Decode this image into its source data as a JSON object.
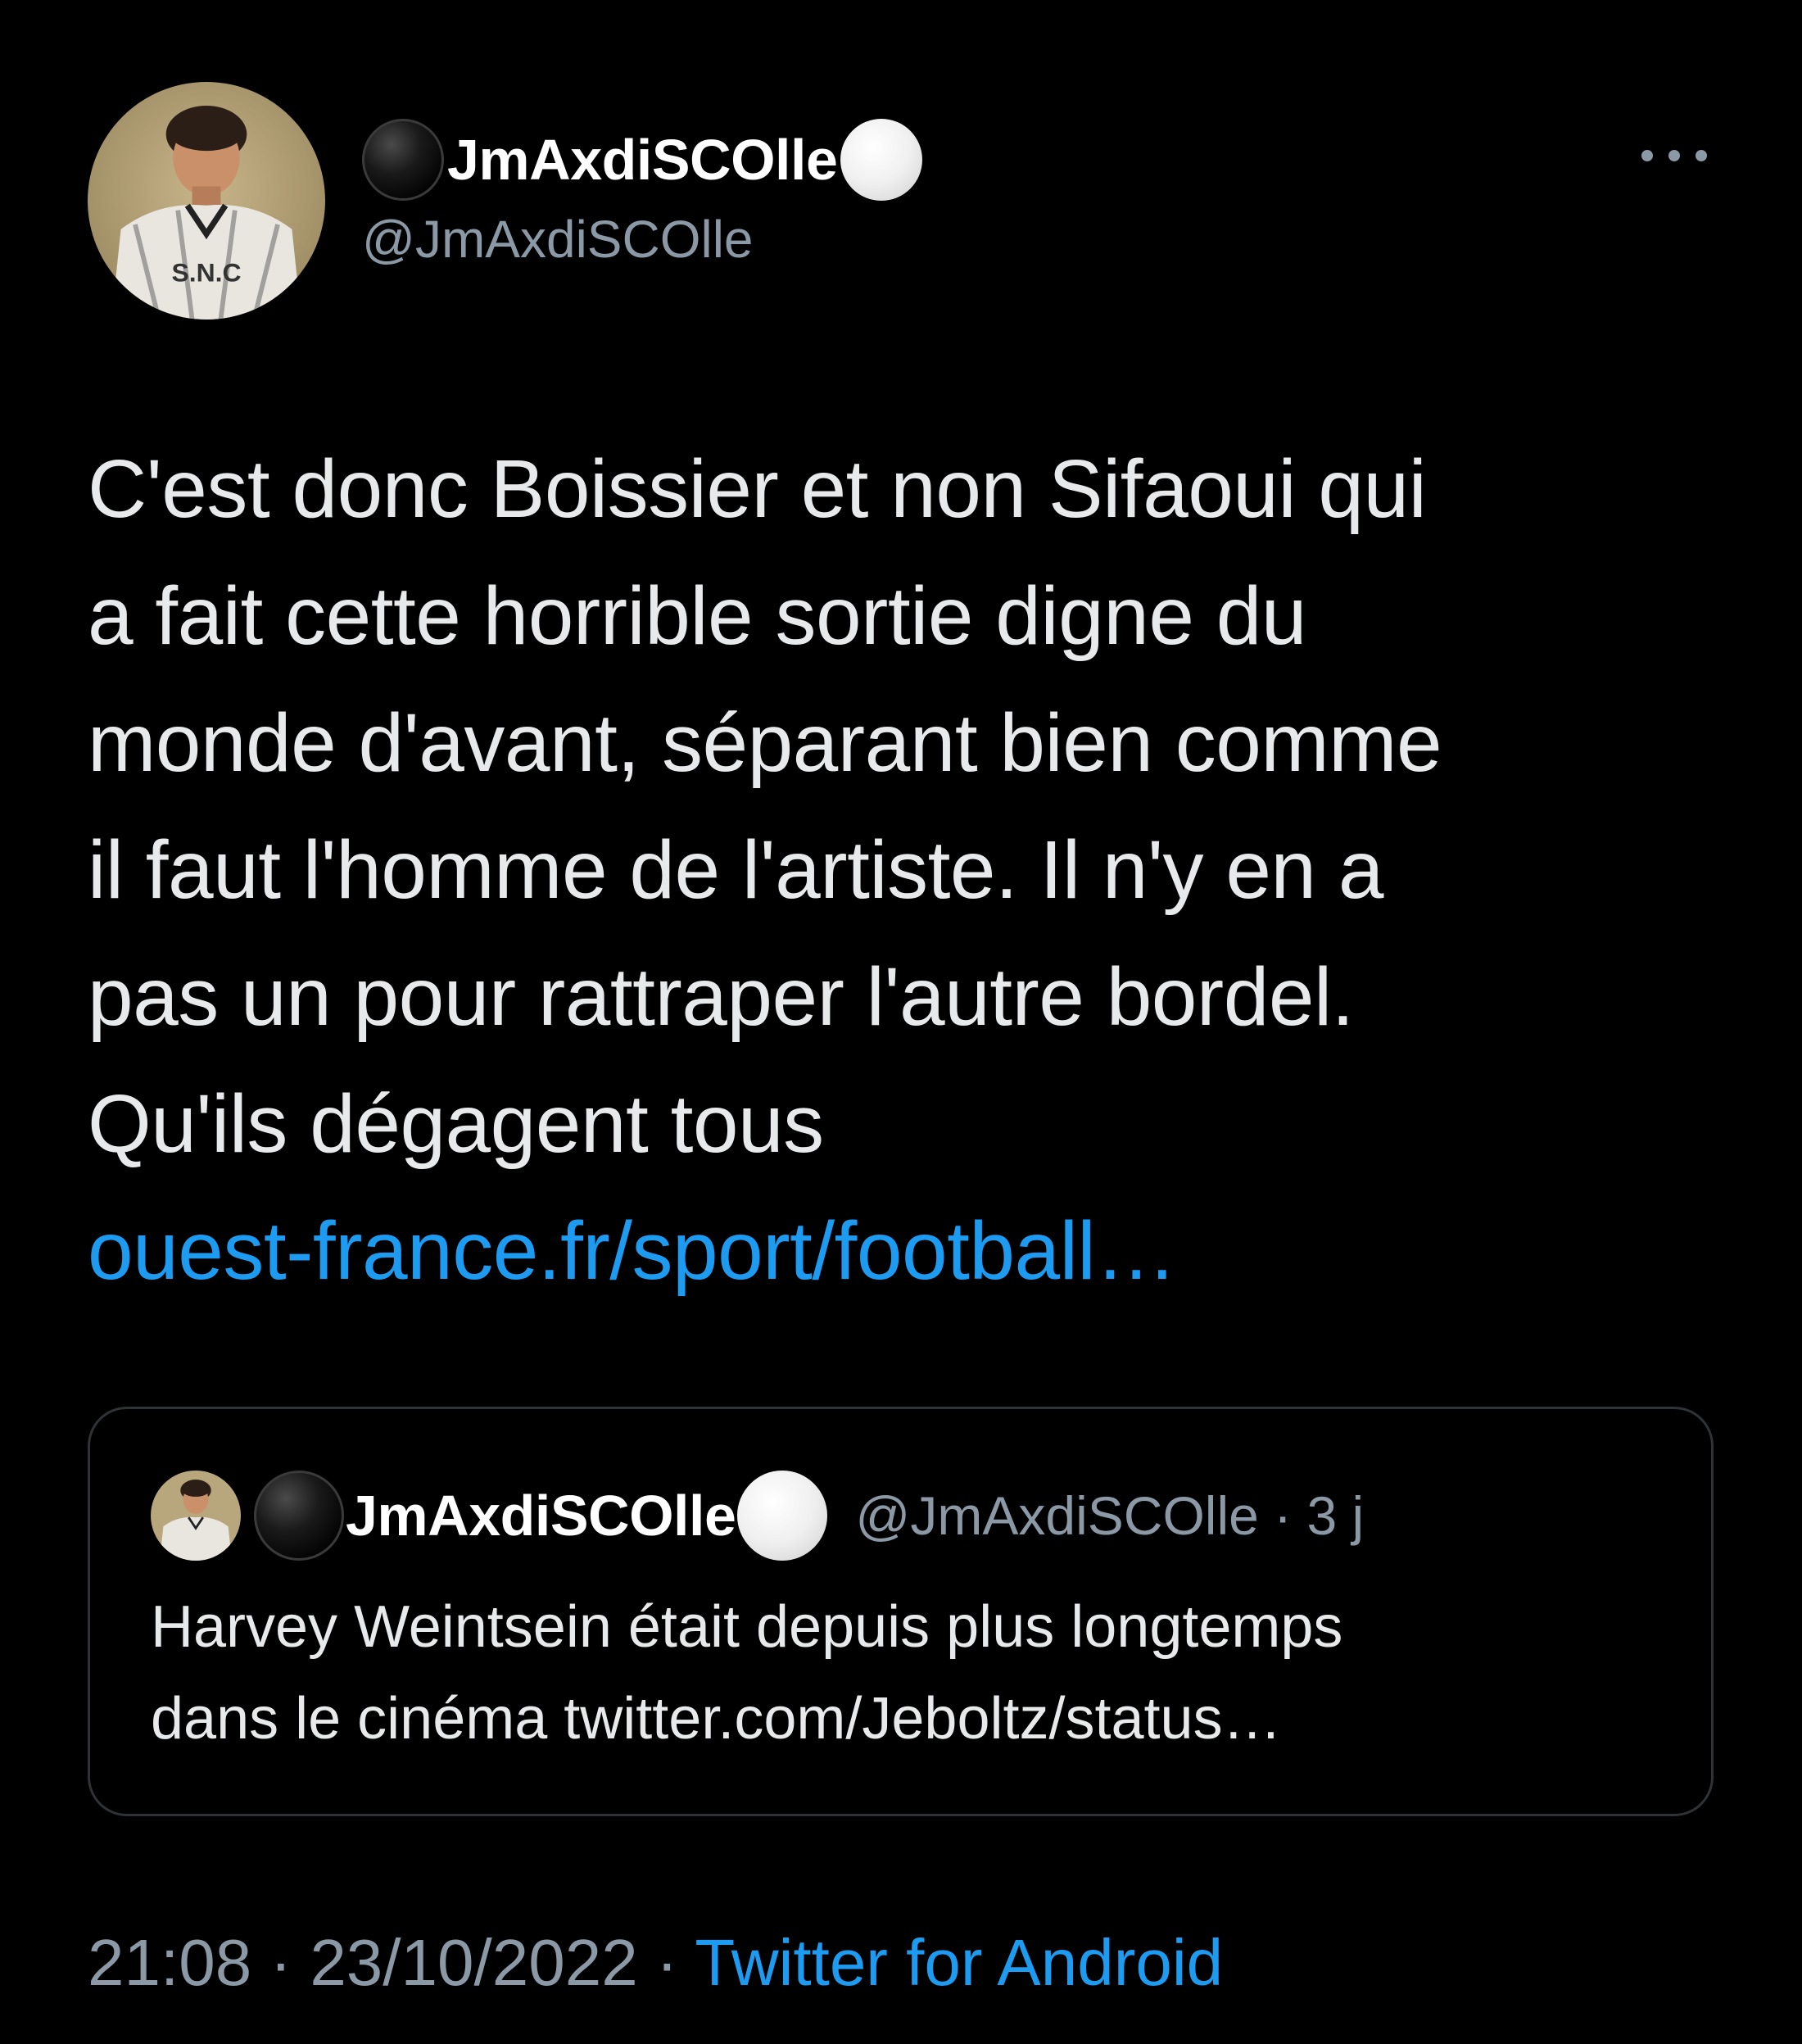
{
  "author": {
    "display_name": "JmAxdiSCOlle",
    "handle": "@JmAxdiSCOlle",
    "avatar_label": "S.N.C"
  },
  "tweet": {
    "lines": [
      "C'est donc Boissier et non Sifaoui qui",
      "a fait cette horrible sortie digne du",
      "monde d'avant, séparant bien comme",
      "il faut l'homme de l'artiste. Il n'y en a",
      "pas un pour rattraper l'autre bordel.",
      "Qu'ils dégagent tous"
    ],
    "link": "ouest-france.fr/sport/football…"
  },
  "quote": {
    "display_name": "JmAxdiSCOlle",
    "handle": "@JmAxdiSCOlle",
    "separator": "·",
    "age": "3 j",
    "lines": [
      "Harvey Weintsein était depuis plus longtemps",
      "dans le cinéma twitter.com/Jeboltz/status…"
    ]
  },
  "footer": {
    "time": "21:08",
    "date": "23/10/2022",
    "separator": "·",
    "source": "Twitter for Android"
  },
  "colors": {
    "background": "#000000",
    "text": "#e7e9ea",
    "muted": "#8b98a5",
    "link": "#1d9bf0",
    "border": "#2f3336"
  }
}
